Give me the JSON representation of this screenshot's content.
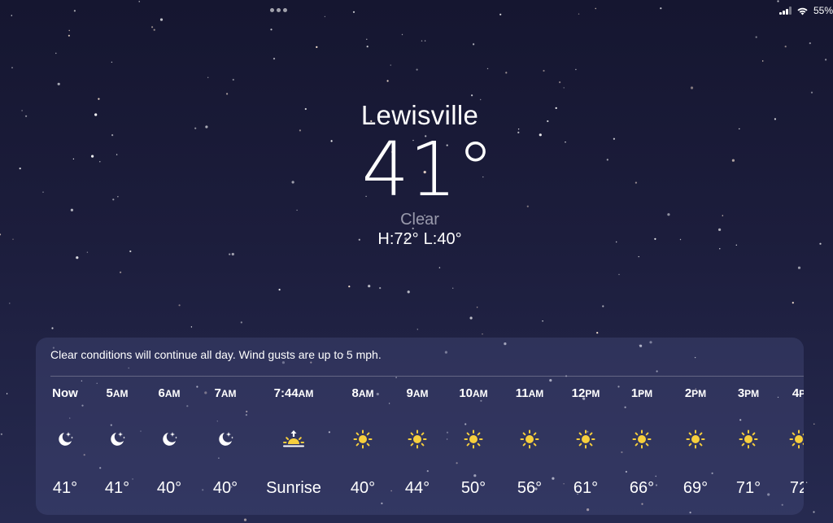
{
  "status_bar": {
    "battery_text": "55%",
    "icons": [
      "cellular-signal-icon",
      "wifi-icon"
    ]
  },
  "location": {
    "city": "Lewisville",
    "temperature": "41°",
    "condition": "Clear",
    "high": "H:72°",
    "low": "L:40°"
  },
  "forecast": {
    "summary": "Clear conditions will continue all day. Wind gusts are up to 5 mph.",
    "hours": [
      {
        "time": "Now",
        "ampm": "",
        "icon": "moon-stars-icon",
        "temp": "41°"
      },
      {
        "time": "5",
        "ampm": "AM",
        "icon": "moon-stars-icon",
        "temp": "41°"
      },
      {
        "time": "6",
        "ampm": "AM",
        "icon": "moon-stars-icon",
        "temp": "40°"
      },
      {
        "time": "7",
        "ampm": "AM",
        "icon": "moon-stars-icon",
        "temp": "40°"
      },
      {
        "time": "7:44",
        "ampm": "AM",
        "icon": "sunrise-icon",
        "temp": "Sunrise"
      },
      {
        "time": "8",
        "ampm": "AM",
        "icon": "sun-icon",
        "temp": "40°"
      },
      {
        "time": "9",
        "ampm": "AM",
        "icon": "sun-icon",
        "temp": "44°"
      },
      {
        "time": "10",
        "ampm": "AM",
        "icon": "sun-icon",
        "temp": "50°"
      },
      {
        "time": "11",
        "ampm": "AM",
        "icon": "sun-icon",
        "temp": "56°"
      },
      {
        "time": "12",
        "ampm": "PM",
        "icon": "sun-icon",
        "temp": "61°"
      },
      {
        "time": "1",
        "ampm": "PM",
        "icon": "sun-icon",
        "temp": "66°"
      },
      {
        "time": "2",
        "ampm": "PM",
        "icon": "sun-icon",
        "temp": "69°"
      },
      {
        "time": "3",
        "ampm": "PM",
        "icon": "sun-icon",
        "temp": "71°"
      },
      {
        "time": "4",
        "ampm": "P",
        "icon": "sun-icon",
        "temp": "72"
      }
    ]
  },
  "colors": {
    "sun": "#f7cf3d",
    "background_top": "#151630",
    "background_bottom": "#262a50"
  }
}
